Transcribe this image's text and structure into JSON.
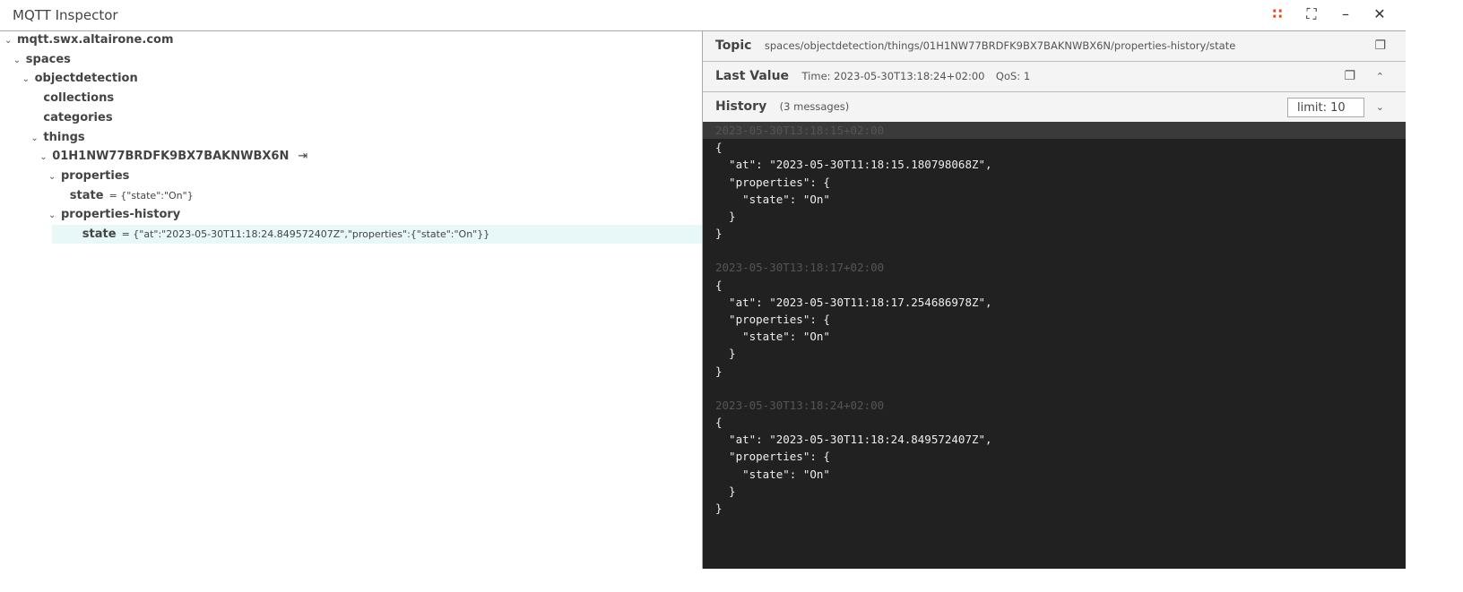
{
  "window": {
    "title": "MQTT Inspector"
  },
  "tree": [
    {
      "label": "mqtt.swx.altairone.com",
      "depth": 0,
      "expanded": true
    },
    {
      "label": "spaces",
      "depth": 1,
      "expanded": true
    },
    {
      "label": "objectdetection",
      "depth": 2,
      "expanded": true
    },
    {
      "label": "collections",
      "depth": 3
    },
    {
      "label": "categories",
      "depth": 3
    },
    {
      "label": "things",
      "depth": 3,
      "expanded": true
    },
    {
      "label": "01H1NW77BRDFK9BX7BAKNWBX6N",
      "depth": 4,
      "expanded": true
    },
    {
      "label": "properties",
      "depth": 5,
      "expanded": true
    },
    {
      "label": "state",
      "depth": 6,
      "value": "= {\"state\":\"On\"}"
    },
    {
      "label": "properties-history",
      "depth": 5,
      "expanded": true
    },
    {
      "label": "state",
      "depth": 6,
      "value": "= {\"at\":\"2023-05-30T11:18:24.849572407Z\",\"properties\":{\"state\":\"On\"}}",
      "selected": true
    }
  ],
  "topic": {
    "label": "Topic",
    "value": "spaces/objectdetection/things/01H1NW77BRDFK9BX7BAKNWBX6N/properties-history/state"
  },
  "last_value": {
    "label": "Last Value",
    "time": "Time: 2023-05-30T13:18:24+02:00",
    "qos": "QoS: 1"
  },
  "history": {
    "label": "History",
    "count": "(3 messages)",
    "limit": "limit: 10",
    "messages": [
      {
        "ts": "2023-05-30T13:18:15+02:00",
        "body": "{\n  \"at\": \"2023-05-30T11:18:15.180798068Z\",\n  \"properties\": {\n    \"state\": \"On\"\n  }\n}"
      },
      {
        "ts": "2023-05-30T13:18:17+02:00",
        "body": "{\n  \"at\": \"2023-05-30T11:18:17.254686978Z\",\n  \"properties\": {\n    \"state\": \"On\"\n  }\n}"
      },
      {
        "ts": "2023-05-30T13:18:24+02:00",
        "body": "{\n  \"at\": \"2023-05-30T11:18:24.849572407Z\",\n  \"properties\": {\n    \"state\": \"On\"\n  }\n}"
      }
    ]
  },
  "colors": {
    "accent": "#e5461c",
    "selection": "#e8f7f7",
    "history_bg": "#212121"
  }
}
